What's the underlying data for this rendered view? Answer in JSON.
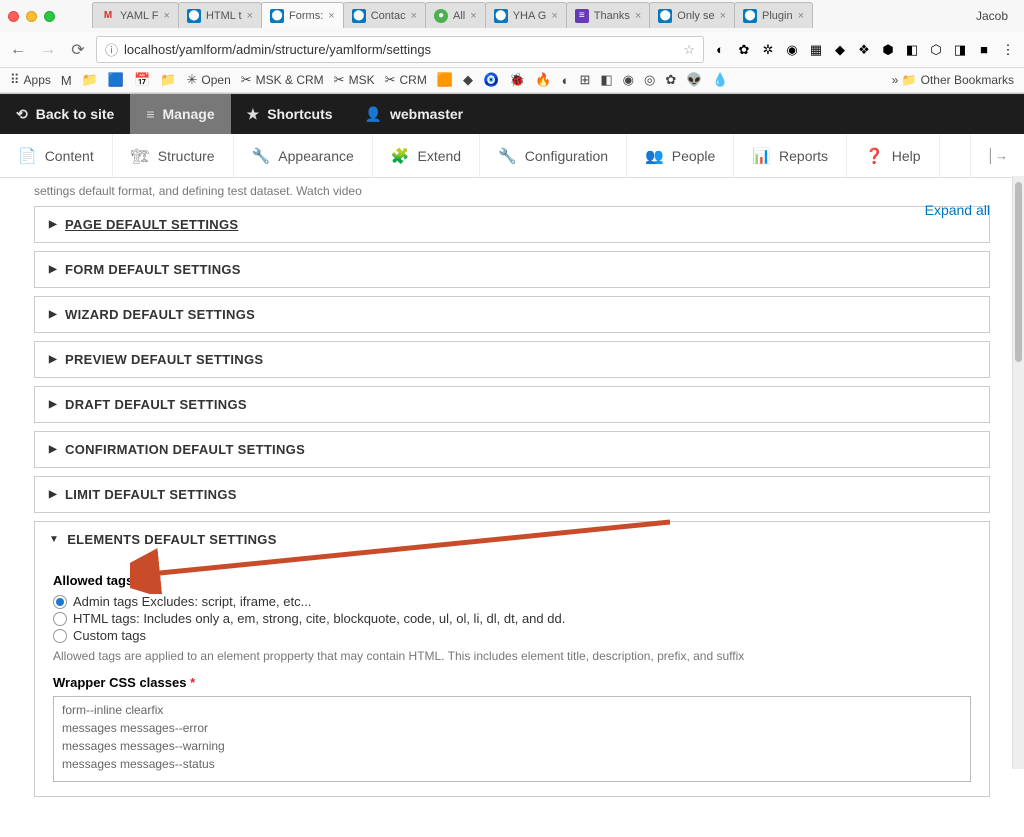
{
  "browser": {
    "profile": "Jacob",
    "url": "localhost/yamlform/admin/structure/yamlform/settings",
    "tabs": [
      {
        "label": "YAML F",
        "icon": "gmail"
      },
      {
        "label": "HTML t",
        "icon": "drupal"
      },
      {
        "label": "Forms:",
        "icon": "drupal",
        "active": true
      },
      {
        "label": "Contac",
        "icon": "drupal"
      },
      {
        "label": "All",
        "icon": "green"
      },
      {
        "label": "YHA G",
        "icon": "drupal"
      },
      {
        "label": "Thanks",
        "icon": "purple"
      },
      {
        "label": "Only se",
        "icon": "drupal"
      },
      {
        "label": "Plugin",
        "icon": "drupal"
      }
    ],
    "bookmarks_label": "Apps",
    "bookmarks": [
      {
        "label": "",
        "ic": "M"
      },
      {
        "label": "",
        "ic": "📁"
      },
      {
        "label": "",
        "ic": "🟦"
      },
      {
        "label": "",
        "ic": "📅"
      },
      {
        "label": "",
        "ic": "📁"
      },
      {
        "label": "Open",
        "ic": "✳"
      },
      {
        "label": "MSK & CRM",
        "ic": "✂"
      },
      {
        "label": "MSK",
        "ic": "✂"
      },
      {
        "label": "CRM",
        "ic": "✂"
      }
    ],
    "other_bookmarks": "Other Bookmarks"
  },
  "toolbar": [
    {
      "label": "Back to site",
      "icon": "⟲"
    },
    {
      "label": "Manage",
      "icon": "≡",
      "active": true
    },
    {
      "label": "Shortcuts",
      "icon": "★"
    },
    {
      "label": "webmaster",
      "icon": "👤"
    }
  ],
  "subtoolbar": [
    {
      "label": "Content",
      "icon": "📄"
    },
    {
      "label": "Structure",
      "icon": "🏗"
    },
    {
      "label": "Appearance",
      "icon": "🔧"
    },
    {
      "label": "Extend",
      "icon": "🧩"
    },
    {
      "label": "Configuration",
      "icon": "🔧"
    },
    {
      "label": "People",
      "icon": "👥"
    },
    {
      "label": "Reports",
      "icon": "📊"
    },
    {
      "label": "Help",
      "icon": "❓"
    }
  ],
  "page": {
    "truncated": "settings default format, and defining test dataset.   Watch video",
    "expand": "Expand all",
    "sections": [
      {
        "label": "PAGE DEFAULT SETTINGS"
      },
      {
        "label": "FORM DEFAULT SETTINGS"
      },
      {
        "label": "WIZARD DEFAULT SETTINGS"
      },
      {
        "label": "PREVIEW DEFAULT SETTINGS"
      },
      {
        "label": "DRAFT DEFAULT SETTINGS"
      },
      {
        "label": "CONFIRMATION DEFAULT SETTINGS"
      },
      {
        "label": "LIMIT DEFAULT SETTINGS"
      }
    ],
    "open_section": {
      "label": "ELEMENTS DEFAULT SETTINGS",
      "allowed_tags_label": "Allowed tags",
      "radios": [
        {
          "label": "Admin tags Excludes: script, iframe, etc...",
          "checked": true
        },
        {
          "label": "HTML tags: Includes only a, em, strong, cite, blockquote, code, ul, ol, li, dl, dt, and dd."
        },
        {
          "label": "Custom tags"
        }
      ],
      "helper": "Allowed tags are applied to an element propperty that may contain HTML. This includes element title, description, prefix, and suffix",
      "wrapper_label": "Wrapper CSS classes",
      "wrapper_lines": [
        "form--inline clearfix",
        "messages messages--error",
        "messages messages--warning",
        "messages messages--status"
      ]
    }
  }
}
